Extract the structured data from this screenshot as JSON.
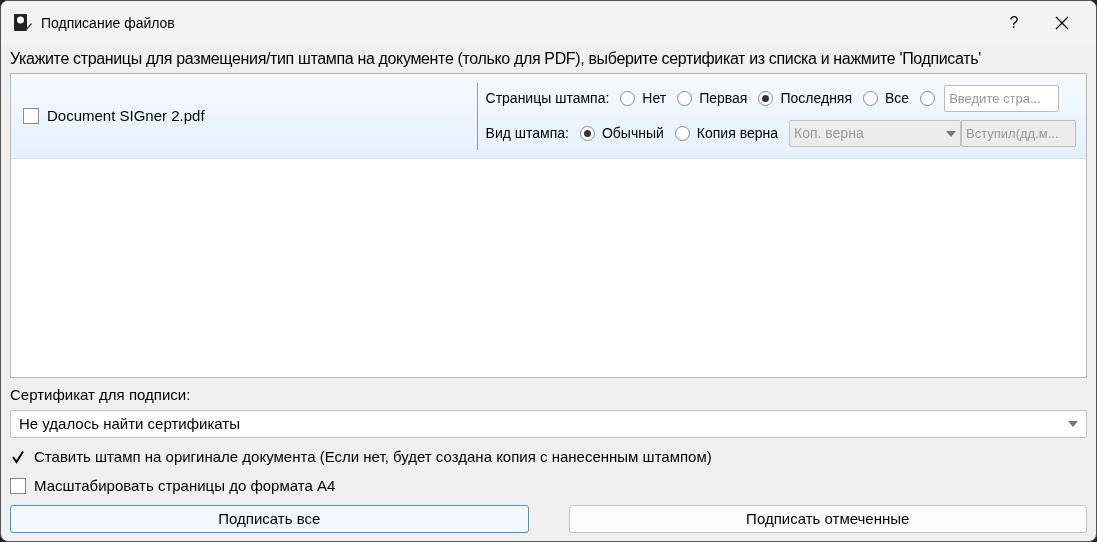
{
  "window": {
    "title": "Подписание файлов",
    "help": "?"
  },
  "instruction": "Укажите страницы для размещения/тип штампа на документе (только для PDF), выберите сертификат из списка и нажмите 'Подписать'",
  "files": [
    {
      "name": "Document SIGner 2.pdf",
      "checked": false,
      "pages_label": "Страницы штампа:",
      "pages_options": [
        {
          "label": "Нет",
          "selected": false
        },
        {
          "label": "Первая",
          "selected": false
        },
        {
          "label": "Последняя",
          "selected": true
        },
        {
          "label": "Все",
          "selected": false
        },
        {
          "kind": "custom",
          "selected": false,
          "placeholder": "Введите стра..."
        }
      ],
      "stamp_label": "Вид штампа:",
      "stamp_options": [
        {
          "label": "Обычный",
          "selected": true
        },
        {
          "label": "Копия верна",
          "selected": false
        }
      ],
      "copy_combo": {
        "value": "Коп. верна",
        "disabled": true
      },
      "date_field": {
        "placeholder": "Вступил(дд.м...",
        "disabled": true
      }
    }
  ],
  "certificate": {
    "label": "Сертификат для подписи:",
    "value": "Не удалось найти сертификаты"
  },
  "options": [
    {
      "label": "Ставить штамп на оригинале документа (Если нет, будет создана копия с нанесенным штампом)",
      "checked": true
    },
    {
      "label": "Масштабировать страницы до формата A4",
      "checked": false
    }
  ],
  "buttons": [
    {
      "label": "Подписать все",
      "focused": true
    },
    {
      "label": "Подписать отмеченные",
      "focused": false
    }
  ]
}
